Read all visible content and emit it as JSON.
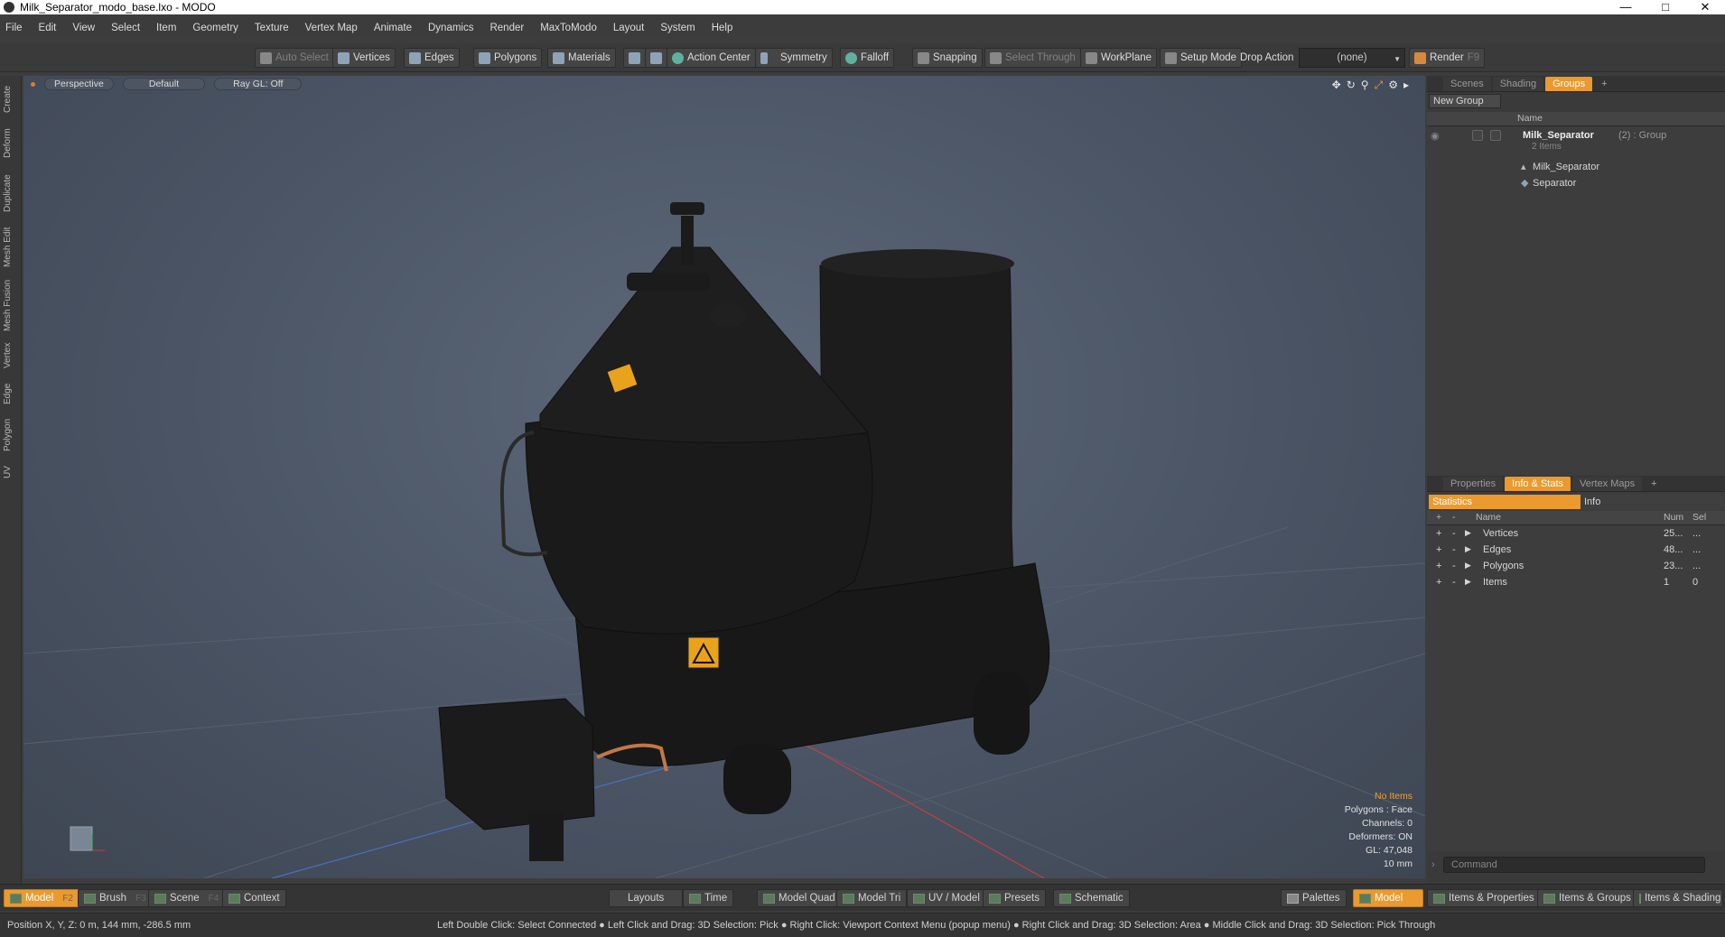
{
  "window": {
    "title": "Milk_Separator_modo_base.lxo - MODO"
  },
  "menu": [
    "File",
    "Edit",
    "View",
    "Select",
    "Item",
    "Geometry",
    "Texture",
    "Vertex Map",
    "Animate",
    "Dynamics",
    "Render",
    "MaxToModo",
    "Layout",
    "System",
    "Help"
  ],
  "toolbar": {
    "auto_select": "Auto Select",
    "vertices": "Vertices",
    "edges": "Edges",
    "polygons": "Polygons",
    "materials": "Materials",
    "action_center": "Action Center",
    "symmetry": "Symmetry",
    "falloff": "Falloff",
    "snapping": "Snapping",
    "select_through": "Select Through",
    "workplane": "WorkPlane",
    "setup_mode": "Setup Mode",
    "drop_action": "Drop Action",
    "drop_value": "(none)",
    "render": "Render",
    "render_key": "F9"
  },
  "left_tabs": [
    "Create",
    "Deform",
    "Duplicate",
    "Mesh Edit",
    "Mesh Fusion",
    "Vertex",
    "Edge",
    "Polygon",
    "UV"
  ],
  "viewport": {
    "perspective": "Perspective",
    "default": "Default",
    "raygl": "Ray GL: Off",
    "stats": {
      "no_items": "No Items",
      "polygons": "Polygons : Face",
      "channels": "Channels: 0",
      "deformers": "Deformers: ON",
      "gl": "GL: 47,048",
      "scale": "10 mm"
    }
  },
  "top_panel": {
    "tabs": [
      "Scenes",
      "Shading",
      "Groups"
    ],
    "new_group": "New Group",
    "name_header": "Name",
    "group": {
      "name": "Milk_Separator",
      "suffix": "(2) : Group",
      "items": "2 Items"
    },
    "children": [
      "Milk_Separator",
      "Separator"
    ]
  },
  "bottom_panel": {
    "tabs": [
      "Properties",
      "Info & Stats",
      "Vertex Maps"
    ],
    "statistics": "Statistics",
    "info": "Info",
    "headers": {
      "name": "Name",
      "num": "Num",
      "sel": "Sel"
    },
    "rows": [
      {
        "name": "Vertices",
        "num": "25...",
        "sel": "..."
      },
      {
        "name": "Edges",
        "num": "48...",
        "sel": "..."
      },
      {
        "name": "Polygons",
        "num": "23...",
        "sel": "..."
      },
      {
        "name": "Items",
        "num": "1",
        "sel": "0"
      }
    ],
    "command_placeholder": "Command"
  },
  "bottom_bar": {
    "model": "Model",
    "model_key": "F2",
    "brush": "Brush",
    "brush_key": "F3",
    "scene": "Scene",
    "scene_key": "F4",
    "context": "Context",
    "layouts": "Layouts",
    "time": "Time",
    "model_quad": "Model Quad",
    "model_tri": "Model Tri",
    "uv_model": "UV / Model",
    "presets": "Presets",
    "schematic": "Schematic",
    "palettes": "Palettes",
    "model2": "Model",
    "items_props": "Items & Properties",
    "items_groups": "Items & Groups",
    "items_shading": "Items & Shading"
  },
  "status": {
    "position": "Position X, Y, Z:  0 m, 144 mm, -286.5 mm",
    "hint": "Left Double Click: Select Connected ● Left Click and Drag: 3D Selection: Pick ● Right Click: Viewport Context Menu (popup menu) ● Right Click and Drag: 3D Selection: Area ● Middle Click and Drag: 3D Selection: Pick Through"
  }
}
